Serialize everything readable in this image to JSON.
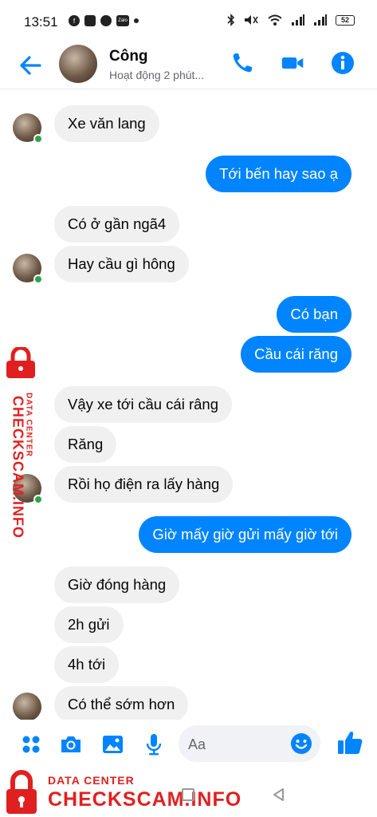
{
  "status_bar": {
    "time": "13:51",
    "battery": "52",
    "left_icons": [
      "facebook-icon",
      "shield-app-icon",
      "messenger-icon",
      "zalo-icon"
    ],
    "zalo_label": "Zalo"
  },
  "header": {
    "name": "Công",
    "status": "Hoạt động 2 phút..."
  },
  "messages": [
    {
      "dir": "in",
      "text": "Xe văn lang"
    },
    {
      "dir": "out",
      "text": "Tới bến hay sao ạ"
    },
    {
      "dir": "in",
      "text": "Có ở gần ngã4"
    },
    {
      "dir": "in",
      "text": "Hay cầu gì hông"
    },
    {
      "dir": "out",
      "text": "Có bạn"
    },
    {
      "dir": "out",
      "text": "Cầu cái răng"
    },
    {
      "dir": "in",
      "text": "Vậy xe tới cầu cái râng"
    },
    {
      "dir": "in",
      "text": "Răng"
    },
    {
      "dir": "in",
      "text": "Rồi họ điện ra lấy hàng"
    },
    {
      "dir": "out",
      "text": "Giờ mấy giờ gửi mấy giờ tới"
    },
    {
      "dir": "in",
      "text": "Giờ đóng hàng"
    },
    {
      "dir": "in",
      "text": "2h gửi"
    },
    {
      "dir": "in",
      "text": "4h tới"
    },
    {
      "dir": "in",
      "text": "Có thể sớm hơn"
    }
  ],
  "composer": {
    "placeholder": "Aa"
  },
  "watermark": {
    "sub": "DATA CENTER",
    "brand": "CHECKSCAM.INFO"
  },
  "colors": {
    "accent": "#0084ff",
    "incoming_bubble": "#f0f0f0",
    "online": "#31a24c",
    "watermark": "#e02020"
  }
}
